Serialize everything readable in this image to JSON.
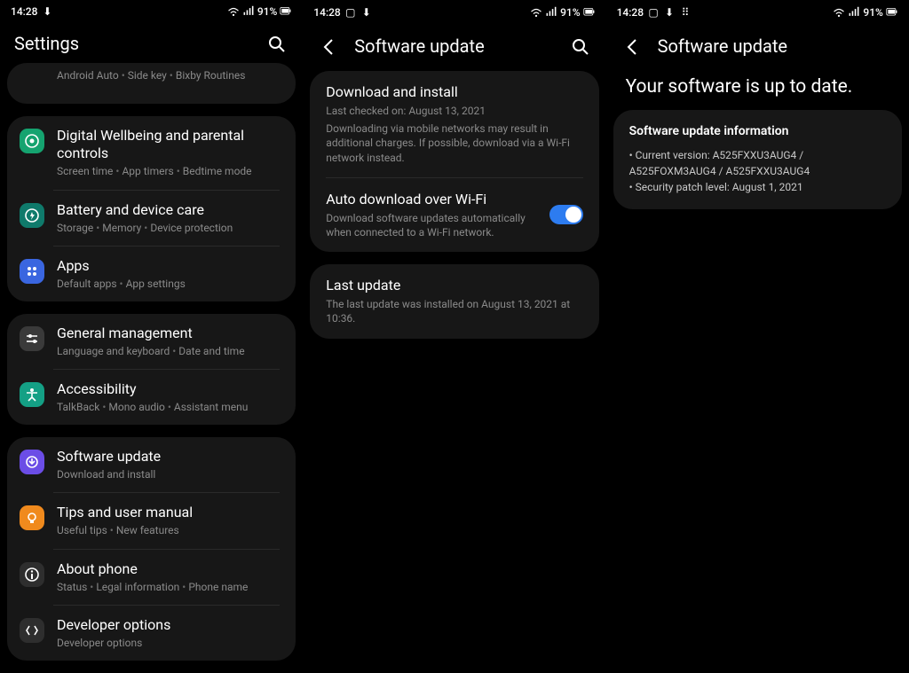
{
  "statusbar": {
    "time": "14:28",
    "battery": "91%"
  },
  "panel1": {
    "title": "Settings",
    "groups": [
      {
        "items": [
          {
            "title_partial": "",
            "sub": [
              "Android Auto",
              "Side key",
              "Bixby Routines"
            ],
            "icon": "gear",
            "color": "gray",
            "clipped": true
          }
        ]
      },
      {
        "items": [
          {
            "title": "Digital Wellbeing and parental controls",
            "sub": [
              "Screen time",
              "App timers",
              "Bedtime mode"
            ],
            "icon": "wellbeing",
            "color": "green"
          },
          {
            "title": "Battery and device care",
            "sub": [
              "Storage",
              "Memory",
              "Device protection"
            ],
            "icon": "battery",
            "color": "teal"
          },
          {
            "title": "Apps",
            "sub": [
              "Default apps",
              "App settings"
            ],
            "icon": "apps",
            "color": "dblue"
          }
        ]
      },
      {
        "items": [
          {
            "title": "General management",
            "sub": [
              "Language and keyboard",
              "Date and time"
            ],
            "icon": "sliders",
            "color": "gray"
          },
          {
            "title": "Accessibility",
            "sub": [
              "TalkBack",
              "Mono audio",
              "Assistant menu"
            ],
            "icon": "accessibility",
            "color": "tealg"
          }
        ]
      },
      {
        "items": [
          {
            "title": "Software update",
            "sub": [
              "Download and install"
            ],
            "icon": "update",
            "color": "purple"
          },
          {
            "title": "Tips and user manual",
            "sub": [
              "Useful tips",
              "New features"
            ],
            "icon": "tips",
            "color": "orange"
          },
          {
            "title": "About phone",
            "sub": [
              "Status",
              "Legal information",
              "Phone name"
            ],
            "icon": "info",
            "color": "dgray"
          },
          {
            "title": "Developer options",
            "sub": [
              "Developer options"
            ],
            "icon": "dev",
            "color": "dgray"
          }
        ]
      }
    ]
  },
  "panel2": {
    "title": "Software update",
    "download": {
      "title": "Download and install",
      "line1": "Last checked on: August 13, 2021",
      "line2": "Downloading via mobile networks may result in additional charges. If possible, download via a Wi-Fi network instead."
    },
    "auto": {
      "title": "Auto download over Wi-Fi",
      "sub": "Download software updates automatically when connected to a Wi-Fi network.",
      "on": true
    },
    "last": {
      "title": "Last update",
      "sub": "The last update was installed on August 13, 2021 at 10:36."
    }
  },
  "panel3": {
    "title": "Software update",
    "message": "Your software is up to date.",
    "info_title": "Software update information",
    "lines": [
      "Current version: A525FXXU3AUG4 / A525FOXM3AUG4 / A525FXXU3AUG4",
      "Security patch level: August 1, 2021"
    ]
  }
}
